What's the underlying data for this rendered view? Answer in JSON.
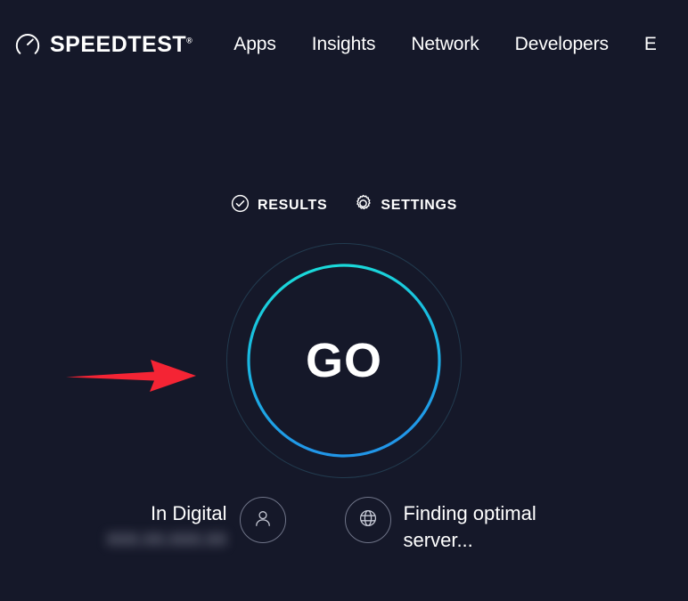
{
  "brand": {
    "name": "SPEEDTEST",
    "trademark": "®",
    "icon": "speedometer-icon"
  },
  "nav": {
    "items": [
      {
        "label": "Apps"
      },
      {
        "label": "Insights"
      },
      {
        "label": "Network"
      },
      {
        "label": "Developers"
      },
      {
        "label": "E"
      }
    ]
  },
  "toolbar": {
    "results_label": "RESULTS",
    "results_icon": "check-circle-icon",
    "settings_label": "SETTINGS",
    "settings_icon": "gear-icon"
  },
  "go": {
    "label": "GO",
    "ring_color_top": "#1ae0d8",
    "ring_color_bottom": "#2196e8",
    "outer_ring_color": "#3c6f86"
  },
  "connection": {
    "isp_name": "In Digital",
    "ip_address": "XXX.XX.XXX.XX",
    "isp_icon": "person-icon",
    "server_icon": "globe-icon",
    "server_status": "Finding optimal server..."
  },
  "annotation": {
    "arrow_color": "#f42434",
    "arrow_icon": "right-arrow-annotation"
  },
  "theme": {
    "background": "#151829",
    "text": "#ffffff",
    "muted": "#6f7488"
  }
}
